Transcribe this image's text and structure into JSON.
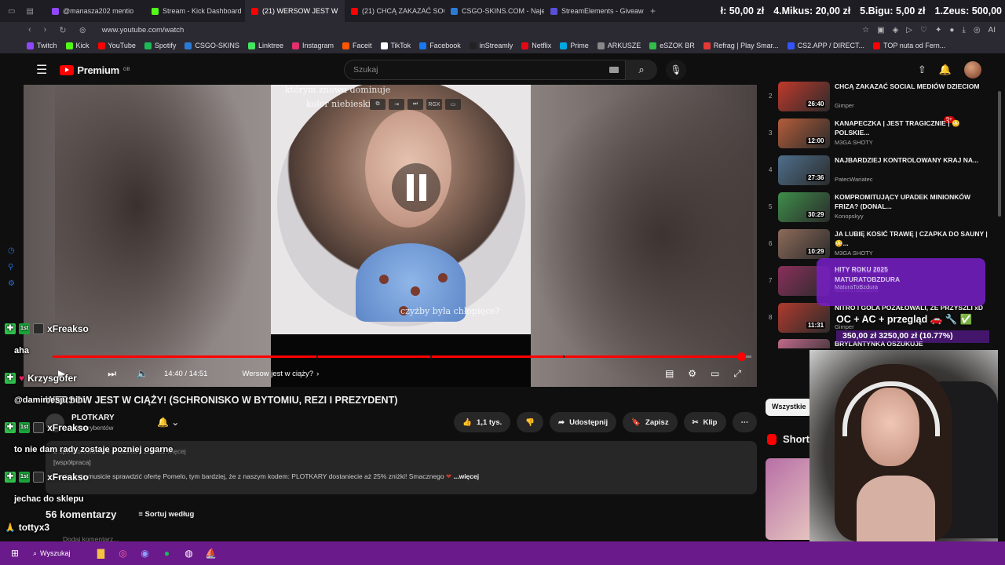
{
  "browser": {
    "tabs": [
      {
        "label": "@manasza202 mentio",
        "color": "#9146ff"
      },
      {
        "label": "Stream - Kick Dashboard",
        "color": "#53fc18"
      },
      {
        "label": "(21) WERSOW JEST W",
        "color": "#ff0000"
      },
      {
        "label": "(21) CHCĄ ZAKAZAĆ SOC",
        "color": "#ff0000"
      },
      {
        "label": "CSGO-SKINS.COM - Naje",
        "color": "#2a7bd6"
      },
      {
        "label": "StreamElements - Giveaw",
        "color": "#5a4fd6"
      }
    ],
    "new_tab": "+",
    "ticker": [
      "ł: 50,00 zł",
      "4.Mikus: 20,00 zł",
      "5.Bigu: 5,00 zł",
      "1.Zeus: 500,00"
    ],
    "url": "www.youtube.com/watch",
    "bookmarks": [
      {
        "label": "Twitch",
        "color": "#9146ff"
      },
      {
        "label": "Kick",
        "color": "#53fc18"
      },
      {
        "label": "YouTube",
        "color": "#ff0000"
      },
      {
        "label": "Spotify",
        "color": "#1db954"
      },
      {
        "label": "CSGO-SKINS",
        "color": "#2a7bd6"
      },
      {
        "label": "Linktree",
        "color": "#43e660"
      },
      {
        "label": "Instagram",
        "color": "#e1306c"
      },
      {
        "label": "Faceit",
        "color": "#ff5500"
      },
      {
        "label": "TikTok",
        "color": "#ffffff"
      },
      {
        "label": "Facebook",
        "color": "#1877f2"
      },
      {
        "label": "inStreamly",
        "color": "#222222"
      },
      {
        "label": "Netflix",
        "color": "#e50914"
      },
      {
        "label": "Prime",
        "color": "#00a8e1"
      },
      {
        "label": "ARKUSZE",
        "color": "#888888"
      },
      {
        "label": "eSZOK BR",
        "color": "#2fbf4a"
      },
      {
        "label": "Refrag | Play Smar...",
        "color": "#e53935"
      },
      {
        "label": "CS2.APP / DIRECT...",
        "color": "#3355ff"
      },
      {
        "label": "TOP nuta od Fern...",
        "color": "#ff0000"
      }
    ]
  },
  "youtube": {
    "logo": "Premium",
    "logo_region": "GB",
    "search_placeholder": "Szukaj",
    "notif_count": "9+",
    "player": {
      "overlay_top": "którym znowu dominuje",
      "overlay_top2": "kolor niebieski",
      "overlay_bottom": "czyżby była chłopięce?",
      "time": "14:40 / 14:51",
      "chapter": "Wersow jest w ciąży?",
      "progress": 0.985,
      "pip_label": "RGX"
    },
    "video_title": "WERSOW JEST W CIĄŻY! (SCHRONISKO W BYTOMIU, REZI I PREZYDENT)",
    "channel": {
      "name": "PLOTKARY",
      "subs": "subskrybentów"
    },
    "actions": {
      "like": "1,1 tys.",
      "share": "Udostępnij",
      "save": "Zapisz",
      "clip": "Klip"
    },
    "description": {
      "line1": "Z sponsorowaniem produktu • Zobacz więcej",
      "line2": "[współpraca]",
      "line3": "Koniecznie musicie sprawdzić ofertę Pomelo, tym bardziej, że z naszym kodem: PLOTKARY dostaniecie aż 25% zniżki! Smacznego",
      "more": "...więcej"
    },
    "comments": {
      "count": "56 komentarzy",
      "sort": "Sortuj według",
      "add": "Dodaj komentarz..."
    },
    "upnext": [
      {
        "num": "2",
        "title": "CHCĄ ZAKAZAĆ SOCIAL MEDIÓW DZIECIOM",
        "channel": "Gimper",
        "duration": "26:40",
        "color": "#c0392b"
      },
      {
        "num": "3",
        "title": "KANAPECZKA | JEST TRAGICZNIE | 😳 POLSKIE...",
        "channel": "M3GA SHOTY",
        "duration": "12:00",
        "color": "#b45d3a"
      },
      {
        "num": "4",
        "title": "NAJBARDZIEJ KONTROLOWANY KRAJ NA...",
        "channel": "PatecWariatec",
        "duration": "27:36",
        "color": "#4e6f8c"
      },
      {
        "num": "5",
        "title": "KOMPROMITUJĄCY UPADEK MINIONKÓW FRIZA? (DONAL...",
        "channel": "Konopskyy",
        "duration": "30:29",
        "color": "#3e8e4a"
      },
      {
        "num": "6",
        "title": "JA LUBIĘ KOSIĆ TRAWĘ | CZAPKA DO SAUNY | 😳...",
        "channel": "M3GA SHOTY",
        "duration": "10:29",
        "color": "#8e6b5a"
      },
      {
        "num": "7",
        "title": "HITY ROKU 2025",
        "channel": "MaturaToBzdura",
        "duration": "",
        "color": "#8a2f5b"
      },
      {
        "num": "8",
        "title": "NITRO I GOLA POŻAŁOWALI, ŻE PRZYSZLI xD",
        "channel": "Gimper",
        "duration": "11:31",
        "color": "#b03a2e"
      },
      {
        "num": "9",
        "title": "BRYLANTYNKA OSZUKUJE",
        "channel": "",
        "duration": "",
        "color": "#c06a8a"
      }
    ],
    "chip_all": "Wszystkie",
    "shorts": "Shorts"
  },
  "stream": {
    "promo_title": "HITY ROKU 2025",
    "promo_sub": "MATURATOBZDURA",
    "promo_ch": "MaturaToBzdura",
    "goal": "OC + AC + przegląd 🚗 🔧 ✅",
    "goal_progress": "350,00 zł  3250,00 zł (10.77%)",
    "chat": [
      {
        "user": "xFreakso",
        "msg": "aha",
        "badge": "1st"
      },
      {
        "user": "Krzysgofer",
        "msg": "@damimesju hihi",
        "badge": ""
      },
      {
        "user": "xFreakso",
        "msg": "to nie dam rady zostaje pozniej ogarne",
        "badge": "1st"
      },
      {
        "user": "xFreakso",
        "msg": "jechac do sklepu",
        "badge": "1st"
      },
      {
        "user": "tottyx3",
        "msg": "",
        "badge": ""
      }
    ]
  },
  "taskbar": {
    "search": "Wyszukaj"
  }
}
